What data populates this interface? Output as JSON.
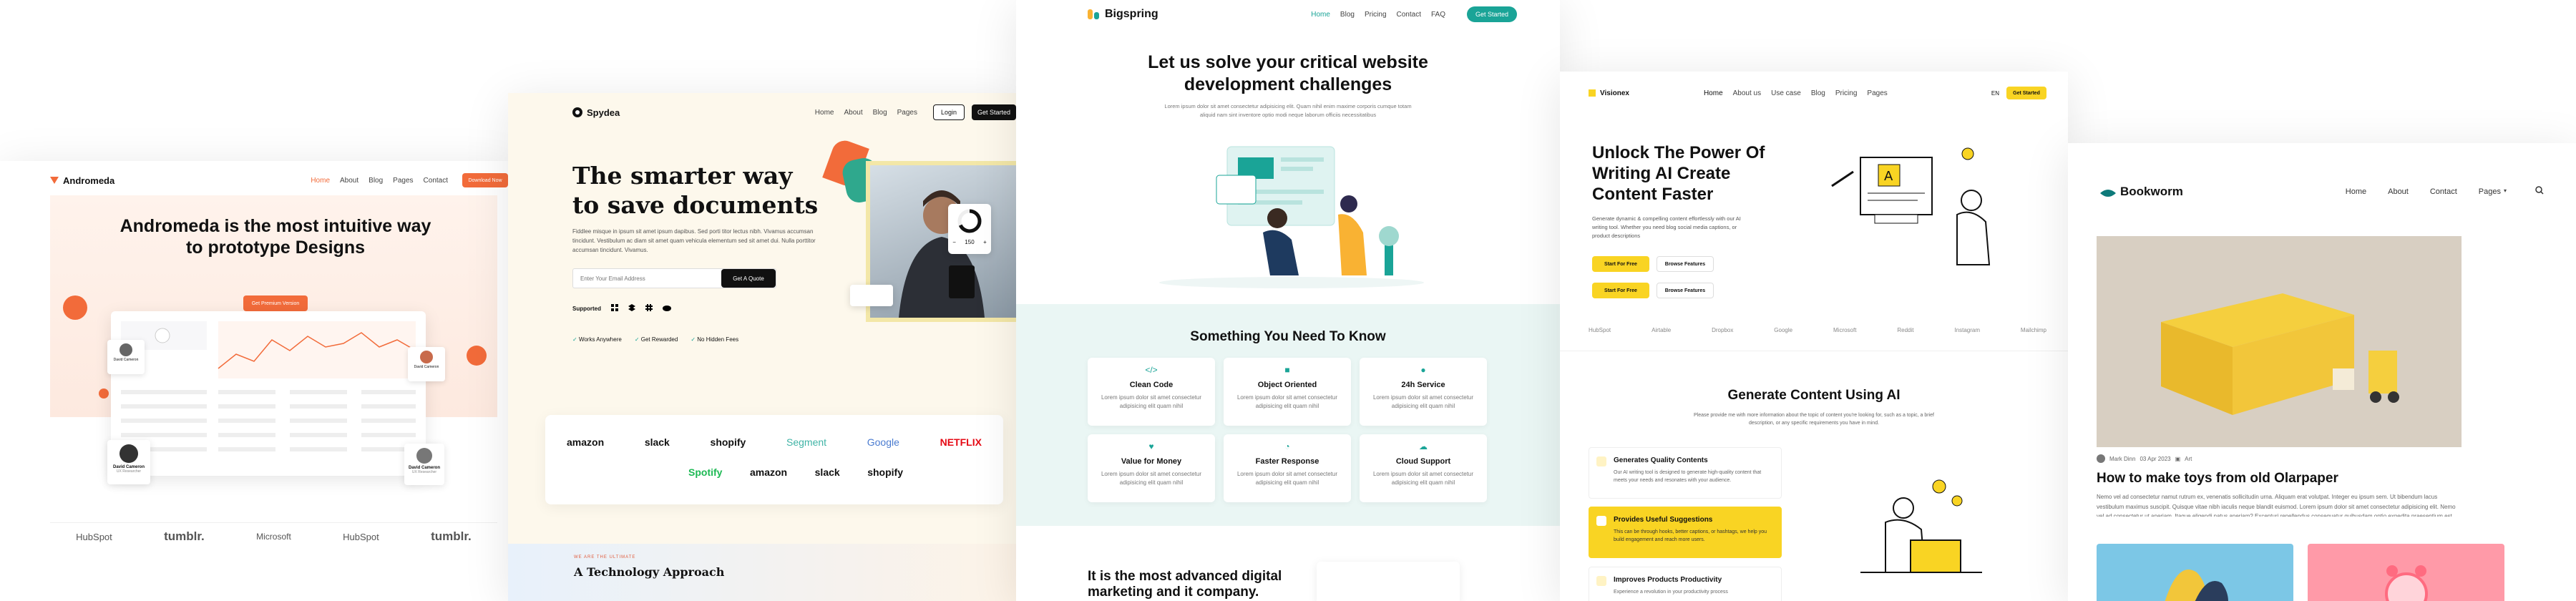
{
  "andromeda": {
    "logo": "Andromeda",
    "nav": [
      "Home",
      "About",
      "Blog",
      "Pages",
      "Contact"
    ],
    "cta": "Download Now",
    "headline": "Andromeda is the most intuitive way to prototype Designs",
    "hero_button": "Get Premium Version",
    "person_left": "David Cameron",
    "person_left_role": "UX Researcher",
    "person_right": "David Cameron",
    "person_right_role": "UX Researcher",
    "person_top_left": "David Cameron",
    "person_top_right": "David Cameron",
    "logos": [
      "HubSpot",
      "tumblr.",
      "Microsoft",
      "HubSpot",
      "tumblr."
    ]
  },
  "spydea": {
    "logo": "Spydea",
    "nav": [
      "Home",
      "About",
      "Blog",
      "Pages"
    ],
    "login": "Login",
    "get_started": "Get Started",
    "headline_1": "The smarter way",
    "headline_2": "to save documents",
    "paragraph": "Fiddlee misque in ipsum sit amet ipsum dapibus. Sed porti titor lectus nibh. Vivamus accumsan tincidunt. Vestibulum ac diam sit amet quam vehicula elementum sed sit amet dui. Nulla porttitor accumsan tincidunt. Vivamus.",
    "email_placeholder": "Enter Your Email Address",
    "quote_button": "Get A Quote",
    "supported_label": "Supported",
    "checks": [
      "Works Anywhere",
      "Get Rewarded",
      "No Hidden Fees"
    ],
    "partners_row1": [
      "amazon",
      "slack",
      "shopify",
      "Segment",
      "Google",
      "NETFLIX"
    ],
    "partners_row2": [
      "Spotify",
      "amazon",
      "slack",
      "shopify"
    ],
    "section_kicker": "WE ARE THE ULTIMATE",
    "section_title": "A Technology Approach",
    "widget_value": "150",
    "widget_minus": "−",
    "widget_plus": "+"
  },
  "bigspring": {
    "logo": "Bigspring",
    "nav": [
      "Home",
      "Blog",
      "Pricing",
      "Contact",
      "FAQ"
    ],
    "cta": "Get Started",
    "headline": "Let us solve your critical website development challenges",
    "paragraph": "Lorem ipsum dolor sit amet consectetur adipisicing elit. Quam nihil enim maxime corporis cumque totam aliquid nam sint inventore optio modi neque laborum officiis necessitatibus",
    "section_title": "Something You Need To Know",
    "features": [
      {
        "title": "Clean Code",
        "desc": "Lorem ipsum dolor sit amet consectetur adipisicing elit quam nihil"
      },
      {
        "title": "Object Oriented",
        "desc": "Lorem ipsum dolor sit amet consectetur adipisicing elit quam nihil"
      },
      {
        "title": "24h Service",
        "desc": "Lorem ipsum dolor sit amet consectetur adipisicing elit quam nihil"
      },
      {
        "title": "Value for Money",
        "desc": "Lorem ipsum dolor sit amet consectetur adipisicing elit quam nihil"
      },
      {
        "title": "Faster Response",
        "desc": "Lorem ipsum dolor sit amet consectetur adipisicing elit quam nihil"
      },
      {
        "title": "Cloud Support",
        "desc": "Lorem ipsum dolor sit amet consectetur adipisicing elit quam nihil"
      }
    ],
    "bottom_title": "It is the most advanced digital marketing and it company."
  },
  "visionex": {
    "logo": "Visionex",
    "nav": [
      "Home",
      "About us",
      "Use case",
      "Blog",
      "Pricing",
      "Pages"
    ],
    "lang": "EN",
    "cta": "Get Started",
    "headline": "Unlock The Power Of Writing AI Create Content Faster",
    "paragraph": "Generate dynamic & compelling content effortlessly with our AI writing tool. Whether you need blog social media captions, or product descriptions",
    "btn_primary_1": "Start For Free",
    "btn_secondary_1": "Browse Features",
    "btn_primary_2": "Start For Free",
    "btn_secondary_2": "Browse Features",
    "logos": [
      "HubSpot",
      "Airtable",
      "Dropbox",
      "Google",
      "Microsoft",
      "Reddit",
      "Instagram",
      "Mailchimp"
    ],
    "section_title": "Generate Content Using AI",
    "section_paragraph": "Please provide me with more information about the topic of content you're looking for, such as a topic, a brief description, or any specific requirements you have in mind.",
    "items": [
      {
        "title": "Generates Quality Contents",
        "desc": "Our AI writing tool is designed to generate high-quality content that meets your needs and resonates with your audience."
      },
      {
        "title": "Provides Useful Suggestions",
        "desc": "This can be through hooks, better captions, or hashtags, we help you build engagement and reach more users."
      },
      {
        "title": "Improves Products Productivity",
        "desc": "Experience a revolution in your productivity process"
      }
    ]
  },
  "bookworm": {
    "logo": "Bookworm",
    "nav": [
      "Home",
      "About",
      "Contact",
      "Pages"
    ],
    "author": "Mark Dinn",
    "date": "03 Apr 2023",
    "category": "Art",
    "post_title": "How to make toys from old Olarpaper",
    "post_excerpt": "Nemo vel ad consectetur namut rutrum ex, venenatis sollicitudin urna. Aliquam erat volutpat. Integer eu ipsum sem. Ut bibendum lacus vestibulum maximus suscipit. Quisque vitae nibh iaculis neque blandit euismod. Lorem ipsum dolor sit amet consectetur adipisicing elit. Nemo vel ad consectetur ut aperiam. Itaque eligendi natus aperiam? Excepturi repellendus consequatur quibusdam optio expedita praesentium est adipisci dolorem ut eius!"
  },
  "colors": {
    "andromeda_orange": "#f26b3a",
    "spydea_dark": "#111111",
    "bigspring_teal": "#1aa497",
    "bigspring_mint": "#eaf6f4",
    "visionex_yellow": "#f9d423",
    "bookworm_teal": "#0e7a7a"
  }
}
